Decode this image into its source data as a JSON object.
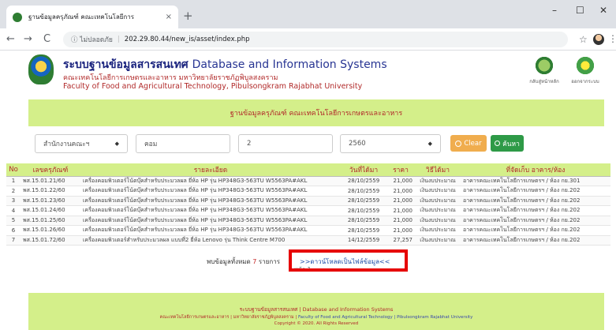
{
  "browser": {
    "tab_title": "ฐานข้อมูลครุภัณฑ์ คณะเทคโนโลยีการ",
    "tab_close": "×",
    "new_tab": "+",
    "minimize": "–",
    "maximize": "☐",
    "close": "✕",
    "back": "←",
    "forward": "→",
    "reload": "C",
    "security_label": "ⓘ ไม่ปลอดภัย",
    "url": "202.29.80.44/new_is/asset/index.php",
    "bookmark": "☆",
    "menu": "⋮"
  },
  "header": {
    "title_th": "ระบบฐานข้อมูลสารสนเทศ",
    "title_en": "Database and Information Systems",
    "subtitle_th": "คณะเทคโนโลยีการเกษตรและอาหาร มหาวิทยาลัยราชภัฏพิบูลสงคราม",
    "subtitle_en": "Faculty of Food and Agricultural Technology, Pibulsongkram Rajabhat University",
    "home_label": "กลับสู่หน้าหลัก",
    "logout_label": "ออกจากระบบ"
  },
  "banner": {
    "text": "ฐานข้อมูลครุภัณฑ์ คณะเทคโนโลยีการเกษตรและอาหาร"
  },
  "filters": {
    "department": "สำนักงานคณะฯ",
    "keyword": "คอม",
    "number": "2",
    "year": "2560",
    "clear_label": "Clear",
    "search_label": "ค้นหา"
  },
  "table": {
    "headers": [
      "No",
      "เลขครุภัณฑ์",
      "รายละเอียด",
      "วันที่ได้มา",
      "ราคา",
      "วิธีได้มา",
      "ที่จัดเก็บ อาคาร/ห้อง"
    ],
    "rows": [
      [
        "1",
        "พส.15.01.21/60",
        "เครื่องคอมพิวเตอร์โน้ตบุ๊คสำหรับประมวลผล ยี่ห้อ HP รุ่น HP348G3-563TU W5563PA#AKL",
        "28/10/2559",
        "21,000",
        "เงินงบประมาณ",
        "อาคารคณะเทคโนโลยีการเกษตรฯ / ห้อง กย.301"
      ],
      [
        "2",
        "พส.15.01.22/60",
        "เครื่องคอมพิวเตอร์โน้ตบุ๊คสำหรับประมวลผล ยี่ห้อ HP รุ่น HP348G3-563TU W5563PA#AKL",
        "28/10/2559",
        "21,000",
        "เงินงบประมาณ",
        "อาคารคณะเทคโนโลยีการเกษตรฯ / ห้อง กย.202"
      ],
      [
        "3",
        "พส.15.01.23/60",
        "เครื่องคอมพิวเตอร์โน้ตบุ๊คสำหรับประมวลผล ยี่ห้อ HP รุ่น HP348G3-563TU W5563PA#AKL",
        "28/10/2559",
        "21,000",
        "เงินงบประมาณ",
        "อาคารคณะเทคโนโลยีการเกษตรฯ / ห้อง กย.202"
      ],
      [
        "4",
        "พส.15.01.24/60",
        "เครื่องคอมพิวเตอร์โน้ตบุ๊คสำหรับประมวลผล ยี่ห้อ HP รุ่น HP348G3-563TU W5563PA#AKL",
        "28/10/2559",
        "21,000",
        "เงินงบประมาณ",
        "อาคารคณะเทคโนโลยีการเกษตรฯ / ห้อง กย.202"
      ],
      [
        "5",
        "พส.15.01.25/60",
        "เครื่องคอมพิวเตอร์โน้ตบุ๊คสำหรับประมวลผล ยี่ห้อ HP รุ่น HP348G3-563TU W5563PA#AKL",
        "28/10/2559",
        "21,000",
        "เงินงบประมาณ",
        "อาคารคณะเทคโนโลยีการเกษตรฯ / ห้อง กย.202"
      ],
      [
        "6",
        "พส.15.01.26/60",
        "เครื่องคอมพิวเตอร์โน้ตบุ๊คสำหรับประมวลผล ยี่ห้อ HP รุ่น HP348G3-563TU W5563PA#AKL",
        "28/10/2559",
        "21,000",
        "เงินงบประมาณ",
        "อาคารคณะเทคโนโลยีการเกษตรฯ / ห้อง กย.202"
      ],
      [
        "7",
        "พส.15.01.72/60",
        "เครื่องคอมพิวเตอร์สำหรับประมวลผล แบบที่2 ยี่ห้อ Lenovo รุ่น Think Centre M700",
        "14/12/2559",
        "27,257",
        "เงินงบประมาณ",
        "อาคารคณะเทคโนโลยีการเกษตรฯ / ห้อง กย.202"
      ]
    ]
  },
  "summary": {
    "prefix": "พบข้อมูลทั้งหมด",
    "count": "7",
    "suffix": "รายการ",
    "download_link": ">>ดาวน์โหลดเป็นไฟล์ข้อมูล<<",
    "page_info": "หน้า 1"
  },
  "footer": {
    "line1": "ระบบฐานข้อมูลสารสนเทศ | Database and Information Systems",
    "line2_th": "คณะเทคโนโลยีการเกษตรและอาหาร | มหาวิทยาลัยราชภัฏพิบูลสงคราม |",
    "line2_en": "Faculty of Food and Agricultural Technology | Pibulsongkram Rajabhat University",
    "line3": "Copyright © 2020. All Rights Reserved"
  },
  "colors": {
    "accent_green": "#d4ef8a",
    "title_blue": "#1a237e",
    "title_red": "#b12a2a",
    "highlight_red": "#e60000",
    "clear_orange": "#f0ad4e",
    "search_green": "#2e9a47"
  }
}
